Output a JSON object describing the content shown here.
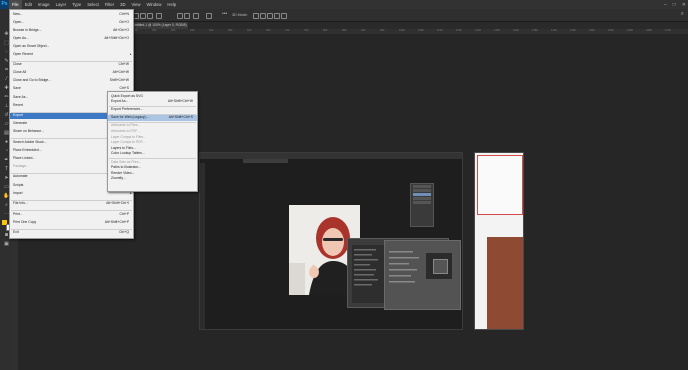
{
  "menubar": {
    "logo": "Ps",
    "items": [
      "File",
      "Edit",
      "Image",
      "Layer",
      "Type",
      "Select",
      "Filter",
      "3D",
      "View",
      "Window",
      "Help"
    ],
    "window_controls": [
      "–",
      "□",
      "✕"
    ]
  },
  "optionsbar": {
    "transform_label": "Show Transform Controls",
    "mode_label": "3D Mode:"
  },
  "document": {
    "tab_label": "Untitled-1 @ 100% (Layer 0, RGB/8) *"
  },
  "ruler": {
    "ticks": [
      "0",
      "50",
      "100",
      "150",
      "200",
      "250",
      "300",
      "350",
      "400",
      "450",
      "500",
      "550",
      "600",
      "650",
      "700",
      "750",
      "800",
      "850",
      "900",
      "950",
      "1000",
      "1050",
      "1100",
      "1150",
      "1200",
      "1250",
      "1300",
      "1350",
      "1400",
      "1450",
      "1500",
      "1550",
      "1600",
      "1650",
      "1700"
    ]
  },
  "file_menu": {
    "items": [
      {
        "label": "New...",
        "shortcut": "Ctrl+N"
      },
      {
        "label": "Open...",
        "shortcut": "Ctrl+O"
      },
      {
        "label": "Browse in Bridge...",
        "shortcut": "Alt+Ctrl+O"
      },
      {
        "label": "Open As...",
        "shortcut": "Alt+Shift+Ctrl+O"
      },
      {
        "label": "Open as Smart Object...",
        "shortcut": ""
      },
      {
        "label": "Open Recent",
        "shortcut": "",
        "submenu": true
      },
      {
        "sep": true
      },
      {
        "label": "Close",
        "shortcut": "Ctrl+W"
      },
      {
        "label": "Close All",
        "shortcut": "Alt+Ctrl+W"
      },
      {
        "label": "Close and Go to Bridge...",
        "shortcut": "Shift+Ctrl+W"
      },
      {
        "label": "Save",
        "shortcut": "Ctrl+S"
      },
      {
        "label": "Save As...",
        "shortcut": "Shift+Ctrl+S"
      },
      {
        "label": "Revert",
        "shortcut": "F12"
      },
      {
        "sep": true
      },
      {
        "label": "Export",
        "shortcut": "",
        "submenu": true,
        "highlight": true
      },
      {
        "label": "Generate",
        "shortcut": "",
        "submenu": true
      },
      {
        "label": "Share on Behance...",
        "shortcut": ""
      },
      {
        "sep": true
      },
      {
        "label": "Search Adobe Stock...",
        "shortcut": ""
      },
      {
        "label": "Place Embedded...",
        "shortcut": "Shift+Ctrl+D"
      },
      {
        "label": "Place Linked...",
        "shortcut": ""
      },
      {
        "label": "Package...",
        "shortcut": "",
        "disabled": true
      },
      {
        "sep": true
      },
      {
        "label": "Automate",
        "shortcut": "",
        "submenu": true
      },
      {
        "label": "Scripts",
        "shortcut": "",
        "submenu": true
      },
      {
        "label": "Import",
        "shortcut": "",
        "submenu": true
      },
      {
        "sep": true
      },
      {
        "label": "File Info...",
        "shortcut": "Alt+Shift+Ctrl+I"
      },
      {
        "sep": true
      },
      {
        "label": "Print...",
        "shortcut": "Ctrl+P"
      },
      {
        "label": "Print One Copy",
        "shortcut": "Alt+Shift+Ctrl+P"
      },
      {
        "sep": true
      },
      {
        "label": "Exit",
        "shortcut": "Ctrl+Q"
      }
    ]
  },
  "export_menu": {
    "items": [
      {
        "label": "Quick Export as SVG",
        "shortcut": ""
      },
      {
        "label": "Export As...",
        "shortcut": "Alt+Shift+Ctrl+W"
      },
      {
        "sep": true
      },
      {
        "label": "Export Preferences...",
        "shortcut": ""
      },
      {
        "sep": true
      },
      {
        "label": "Save for Web (Legacy)...",
        "shortcut": "Alt+Shift+Ctrl+S",
        "highlight": true
      },
      {
        "sep": true
      },
      {
        "label": "Artboards to Files...",
        "shortcut": "",
        "disabled": true
      },
      {
        "label": "Artboards to PDF...",
        "shortcut": "",
        "disabled": true
      },
      {
        "label": "Layer Comps to Files...",
        "shortcut": "",
        "disabled": true
      },
      {
        "label": "Layer Comps to PDF...",
        "shortcut": "",
        "disabled": true
      },
      {
        "label": "Layers to Files...",
        "shortcut": ""
      },
      {
        "label": "Color Lookup Tables...",
        "shortcut": ""
      },
      {
        "sep": true
      },
      {
        "label": "Data Sets as Files...",
        "shortcut": "",
        "disabled": true
      },
      {
        "label": "Paths to Illustrator...",
        "shortcut": ""
      },
      {
        "label": "Render Video...",
        "shortcut": ""
      },
      {
        "label": "Zoomify...",
        "shortcut": ""
      }
    ]
  },
  "colors": {
    "highlight": "#3d78c5",
    "menu_bg": "#f1f1f1",
    "app_bg": "#262626",
    "foreground_swatch": "#ffc400",
    "background_swatch": "#ffffff"
  }
}
